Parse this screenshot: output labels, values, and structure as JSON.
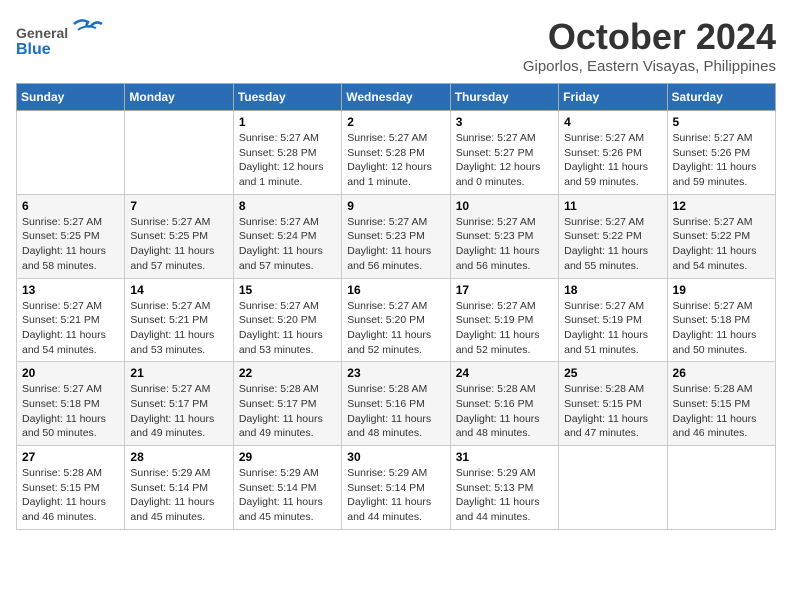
{
  "header": {
    "logo": {
      "general": "General",
      "blue": "Blue"
    },
    "title": "October 2024",
    "location": "Giporlos, Eastern Visayas, Philippines"
  },
  "days_of_week": [
    "Sunday",
    "Monday",
    "Tuesday",
    "Wednesday",
    "Thursday",
    "Friday",
    "Saturday"
  ],
  "weeks": [
    [
      {
        "day": "",
        "info": ""
      },
      {
        "day": "",
        "info": ""
      },
      {
        "day": "1",
        "info": "Sunrise: 5:27 AM\nSunset: 5:28 PM\nDaylight: 12 hours\nand 1 minute."
      },
      {
        "day": "2",
        "info": "Sunrise: 5:27 AM\nSunset: 5:28 PM\nDaylight: 12 hours\nand 1 minute."
      },
      {
        "day": "3",
        "info": "Sunrise: 5:27 AM\nSunset: 5:27 PM\nDaylight: 12 hours\nand 0 minutes."
      },
      {
        "day": "4",
        "info": "Sunrise: 5:27 AM\nSunset: 5:26 PM\nDaylight: 11 hours\nand 59 minutes."
      },
      {
        "day": "5",
        "info": "Sunrise: 5:27 AM\nSunset: 5:26 PM\nDaylight: 11 hours\nand 59 minutes."
      }
    ],
    [
      {
        "day": "6",
        "info": "Sunrise: 5:27 AM\nSunset: 5:25 PM\nDaylight: 11 hours\nand 58 minutes."
      },
      {
        "day": "7",
        "info": "Sunrise: 5:27 AM\nSunset: 5:25 PM\nDaylight: 11 hours\nand 57 minutes."
      },
      {
        "day": "8",
        "info": "Sunrise: 5:27 AM\nSunset: 5:24 PM\nDaylight: 11 hours\nand 57 minutes."
      },
      {
        "day": "9",
        "info": "Sunrise: 5:27 AM\nSunset: 5:23 PM\nDaylight: 11 hours\nand 56 minutes."
      },
      {
        "day": "10",
        "info": "Sunrise: 5:27 AM\nSunset: 5:23 PM\nDaylight: 11 hours\nand 56 minutes."
      },
      {
        "day": "11",
        "info": "Sunrise: 5:27 AM\nSunset: 5:22 PM\nDaylight: 11 hours\nand 55 minutes."
      },
      {
        "day": "12",
        "info": "Sunrise: 5:27 AM\nSunset: 5:22 PM\nDaylight: 11 hours\nand 54 minutes."
      }
    ],
    [
      {
        "day": "13",
        "info": "Sunrise: 5:27 AM\nSunset: 5:21 PM\nDaylight: 11 hours\nand 54 minutes."
      },
      {
        "day": "14",
        "info": "Sunrise: 5:27 AM\nSunset: 5:21 PM\nDaylight: 11 hours\nand 53 minutes."
      },
      {
        "day": "15",
        "info": "Sunrise: 5:27 AM\nSunset: 5:20 PM\nDaylight: 11 hours\nand 53 minutes."
      },
      {
        "day": "16",
        "info": "Sunrise: 5:27 AM\nSunset: 5:20 PM\nDaylight: 11 hours\nand 52 minutes."
      },
      {
        "day": "17",
        "info": "Sunrise: 5:27 AM\nSunset: 5:19 PM\nDaylight: 11 hours\nand 52 minutes."
      },
      {
        "day": "18",
        "info": "Sunrise: 5:27 AM\nSunset: 5:19 PM\nDaylight: 11 hours\nand 51 minutes."
      },
      {
        "day": "19",
        "info": "Sunrise: 5:27 AM\nSunset: 5:18 PM\nDaylight: 11 hours\nand 50 minutes."
      }
    ],
    [
      {
        "day": "20",
        "info": "Sunrise: 5:27 AM\nSunset: 5:18 PM\nDaylight: 11 hours\nand 50 minutes."
      },
      {
        "day": "21",
        "info": "Sunrise: 5:27 AM\nSunset: 5:17 PM\nDaylight: 11 hours\nand 49 minutes."
      },
      {
        "day": "22",
        "info": "Sunrise: 5:28 AM\nSunset: 5:17 PM\nDaylight: 11 hours\nand 49 minutes."
      },
      {
        "day": "23",
        "info": "Sunrise: 5:28 AM\nSunset: 5:16 PM\nDaylight: 11 hours\nand 48 minutes."
      },
      {
        "day": "24",
        "info": "Sunrise: 5:28 AM\nSunset: 5:16 PM\nDaylight: 11 hours\nand 48 minutes."
      },
      {
        "day": "25",
        "info": "Sunrise: 5:28 AM\nSunset: 5:15 PM\nDaylight: 11 hours\nand 47 minutes."
      },
      {
        "day": "26",
        "info": "Sunrise: 5:28 AM\nSunset: 5:15 PM\nDaylight: 11 hours\nand 46 minutes."
      }
    ],
    [
      {
        "day": "27",
        "info": "Sunrise: 5:28 AM\nSunset: 5:15 PM\nDaylight: 11 hours\nand 46 minutes."
      },
      {
        "day": "28",
        "info": "Sunrise: 5:29 AM\nSunset: 5:14 PM\nDaylight: 11 hours\nand 45 minutes."
      },
      {
        "day": "29",
        "info": "Sunrise: 5:29 AM\nSunset: 5:14 PM\nDaylight: 11 hours\nand 45 minutes."
      },
      {
        "day": "30",
        "info": "Sunrise: 5:29 AM\nSunset: 5:14 PM\nDaylight: 11 hours\nand 44 minutes."
      },
      {
        "day": "31",
        "info": "Sunrise: 5:29 AM\nSunset: 5:13 PM\nDaylight: 11 hours\nand 44 minutes."
      },
      {
        "day": "",
        "info": ""
      },
      {
        "day": "",
        "info": ""
      }
    ]
  ]
}
